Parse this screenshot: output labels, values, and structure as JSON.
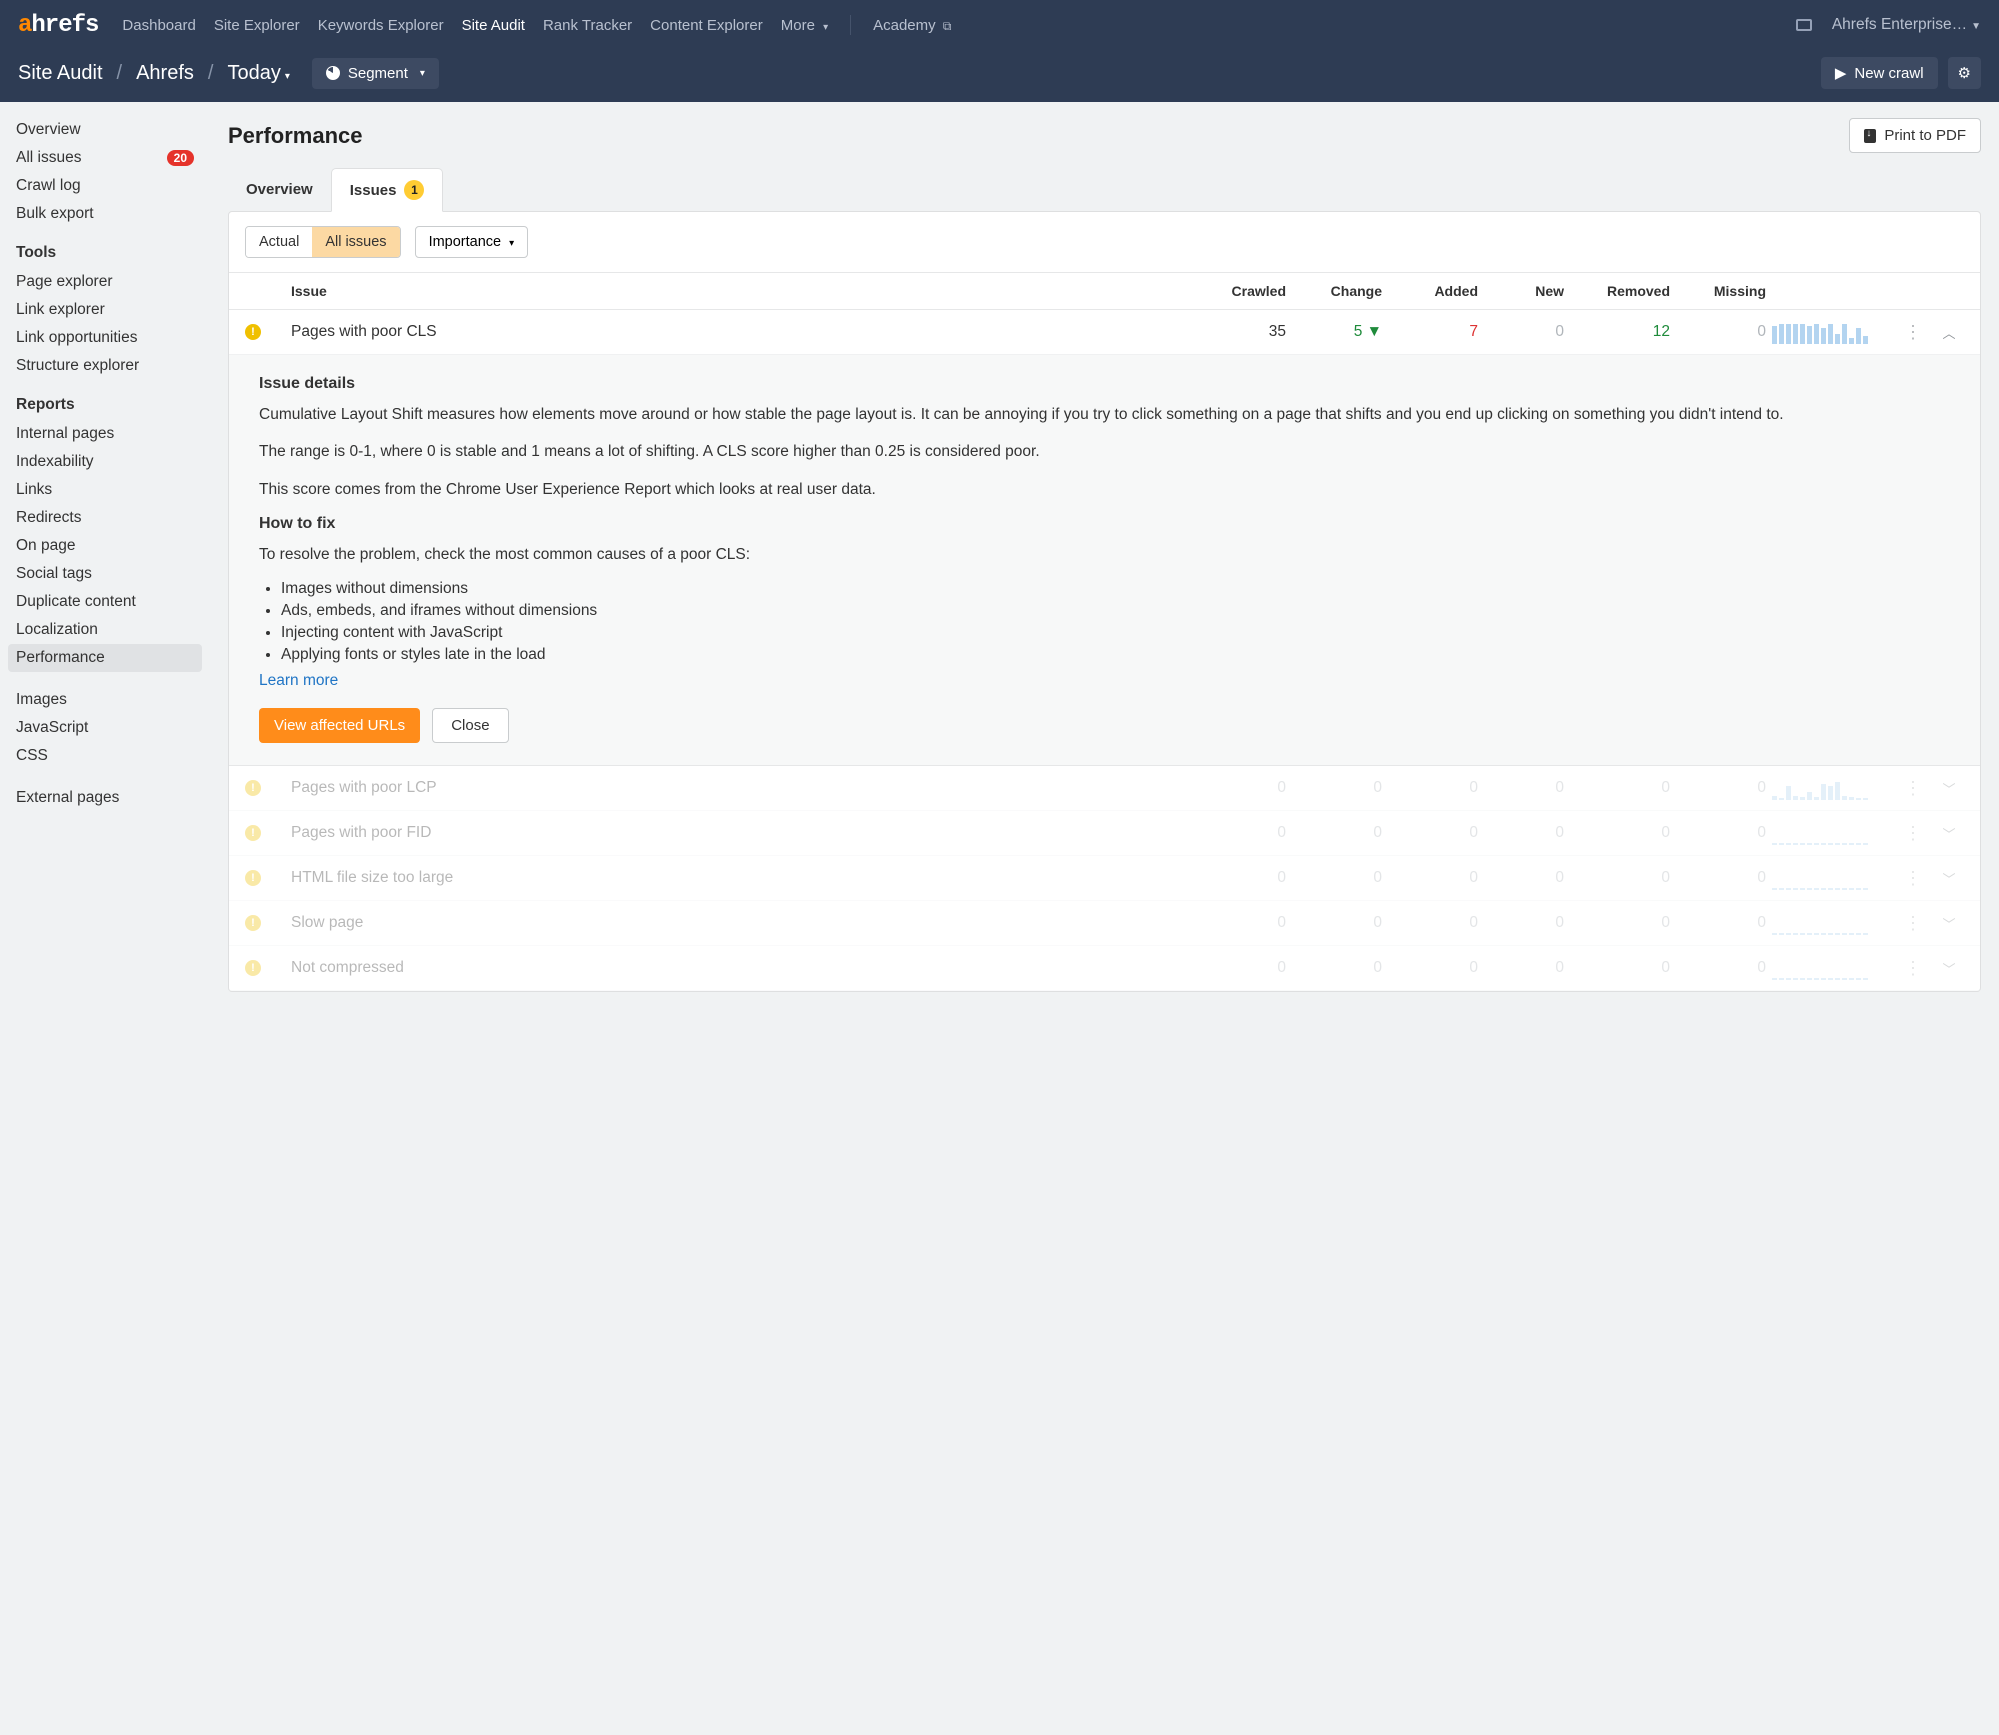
{
  "logo": {
    "a": "a",
    "rest": "hrefs"
  },
  "nav": {
    "items": [
      "Dashboard",
      "Site Explorer",
      "Keywords Explorer",
      "Site Audit",
      "Rank Tracker",
      "Content Explorer",
      "More"
    ],
    "active": "Site Audit",
    "academy": "Academy",
    "enterprise": "Ahrefs Enterprise…"
  },
  "breadcrumb": {
    "section": "Site Audit",
    "project": "Ahrefs",
    "date": "Today"
  },
  "segment_label": "Segment",
  "new_crawl_label": "New crawl",
  "sidebar": {
    "main": [
      {
        "label": "Overview"
      },
      {
        "label": "All issues",
        "badge": "20"
      },
      {
        "label": "Crawl log"
      },
      {
        "label": "Bulk export"
      }
    ],
    "tools_header": "Tools",
    "tools": [
      "Page explorer",
      "Link explorer",
      "Link opportunities",
      "Structure explorer"
    ],
    "reports_header": "Reports",
    "reports": [
      "Internal pages",
      "Indexability",
      "Links",
      "Redirects",
      "On page",
      "Social tags",
      "Duplicate content",
      "Localization",
      "Performance"
    ],
    "active_report": "Performance",
    "extra": [
      "Images",
      "JavaScript",
      "CSS"
    ],
    "external": [
      "External pages"
    ]
  },
  "page_title": "Performance",
  "print_pdf": "Print to PDF",
  "tabs": {
    "overview": "Overview",
    "issues": "Issues",
    "issues_badge": "1"
  },
  "filters": {
    "actual": "Actual",
    "all_issues": "All issues",
    "importance": "Importance"
  },
  "columns": {
    "issue": "Issue",
    "crawled": "Crawled",
    "change": "Change",
    "added": "Added",
    "new": "New",
    "removed": "Removed",
    "missing": "Missing"
  },
  "rows": [
    {
      "name": "Pages with poor CLS",
      "crawled": "35",
      "change": "5",
      "change_dir": "down",
      "added": "7",
      "new": "0",
      "removed": "12",
      "missing": "0",
      "expanded": true,
      "spark": [
        18,
        20,
        20,
        20,
        20,
        18,
        20,
        16,
        20,
        10,
        20,
        6,
        16,
        8
      ]
    },
    {
      "name": "Pages with poor LCP",
      "crawled": "0",
      "change": "0",
      "added": "0",
      "new": "0",
      "removed": "0",
      "missing": "0",
      "dim": true,
      "spark": [
        4,
        2,
        14,
        4,
        3,
        8,
        3,
        16,
        14,
        18,
        4,
        3,
        2,
        2
      ]
    },
    {
      "name": "Pages with poor FID",
      "crawled": "0",
      "change": "0",
      "added": "0",
      "new": "0",
      "removed": "0",
      "missing": "0",
      "dim": true,
      "spark": [
        2,
        2,
        2,
        2,
        2,
        2,
        2,
        2,
        2,
        2,
        2,
        2,
        2,
        2
      ]
    },
    {
      "name": "HTML file size too large",
      "crawled": "0",
      "change": "0",
      "added": "0",
      "new": "0",
      "removed": "0",
      "missing": "0",
      "dim": true,
      "spark": [
        2,
        2,
        2,
        2,
        2,
        2,
        2,
        2,
        2,
        2,
        2,
        2,
        2,
        2
      ]
    },
    {
      "name": "Slow page",
      "crawled": "0",
      "change": "0",
      "added": "0",
      "new": "0",
      "removed": "0",
      "missing": "0",
      "dim": true,
      "spark": [
        2,
        2,
        2,
        2,
        2,
        2,
        2,
        2,
        2,
        2,
        2,
        2,
        2,
        2
      ]
    },
    {
      "name": "Not compressed",
      "crawled": "0",
      "change": "0",
      "added": "0",
      "new": "0",
      "removed": "0",
      "missing": "0",
      "dim": true,
      "spark": [
        2,
        2,
        2,
        2,
        2,
        2,
        2,
        2,
        2,
        2,
        2,
        2,
        2,
        2
      ]
    }
  ],
  "details": {
    "header": "Issue details",
    "p1": "Cumulative Layout Shift measures how elements move around or how stable the page layout is. It can be annoying if you try to click something on a page that shifts and you end up clicking on something you didn't intend to.",
    "p2": "The range is 0-1, where 0 is stable and 1 means a lot of shifting. A CLS score higher than 0.25 is considered poor.",
    "p3": "This score comes from the Chrome User Experience Report which looks at real user data.",
    "fix_header": "How to fix",
    "fix_intro": "To resolve the problem, check the most common causes of a poor CLS:",
    "fix_items": [
      "Images without dimensions",
      "Ads, embeds, and iframes without dimensions",
      "Injecting content with JavaScript",
      "Applying fonts or styles late in the load"
    ],
    "learn_more": "Learn more",
    "view_urls": "View affected URLs",
    "close": "Close"
  }
}
